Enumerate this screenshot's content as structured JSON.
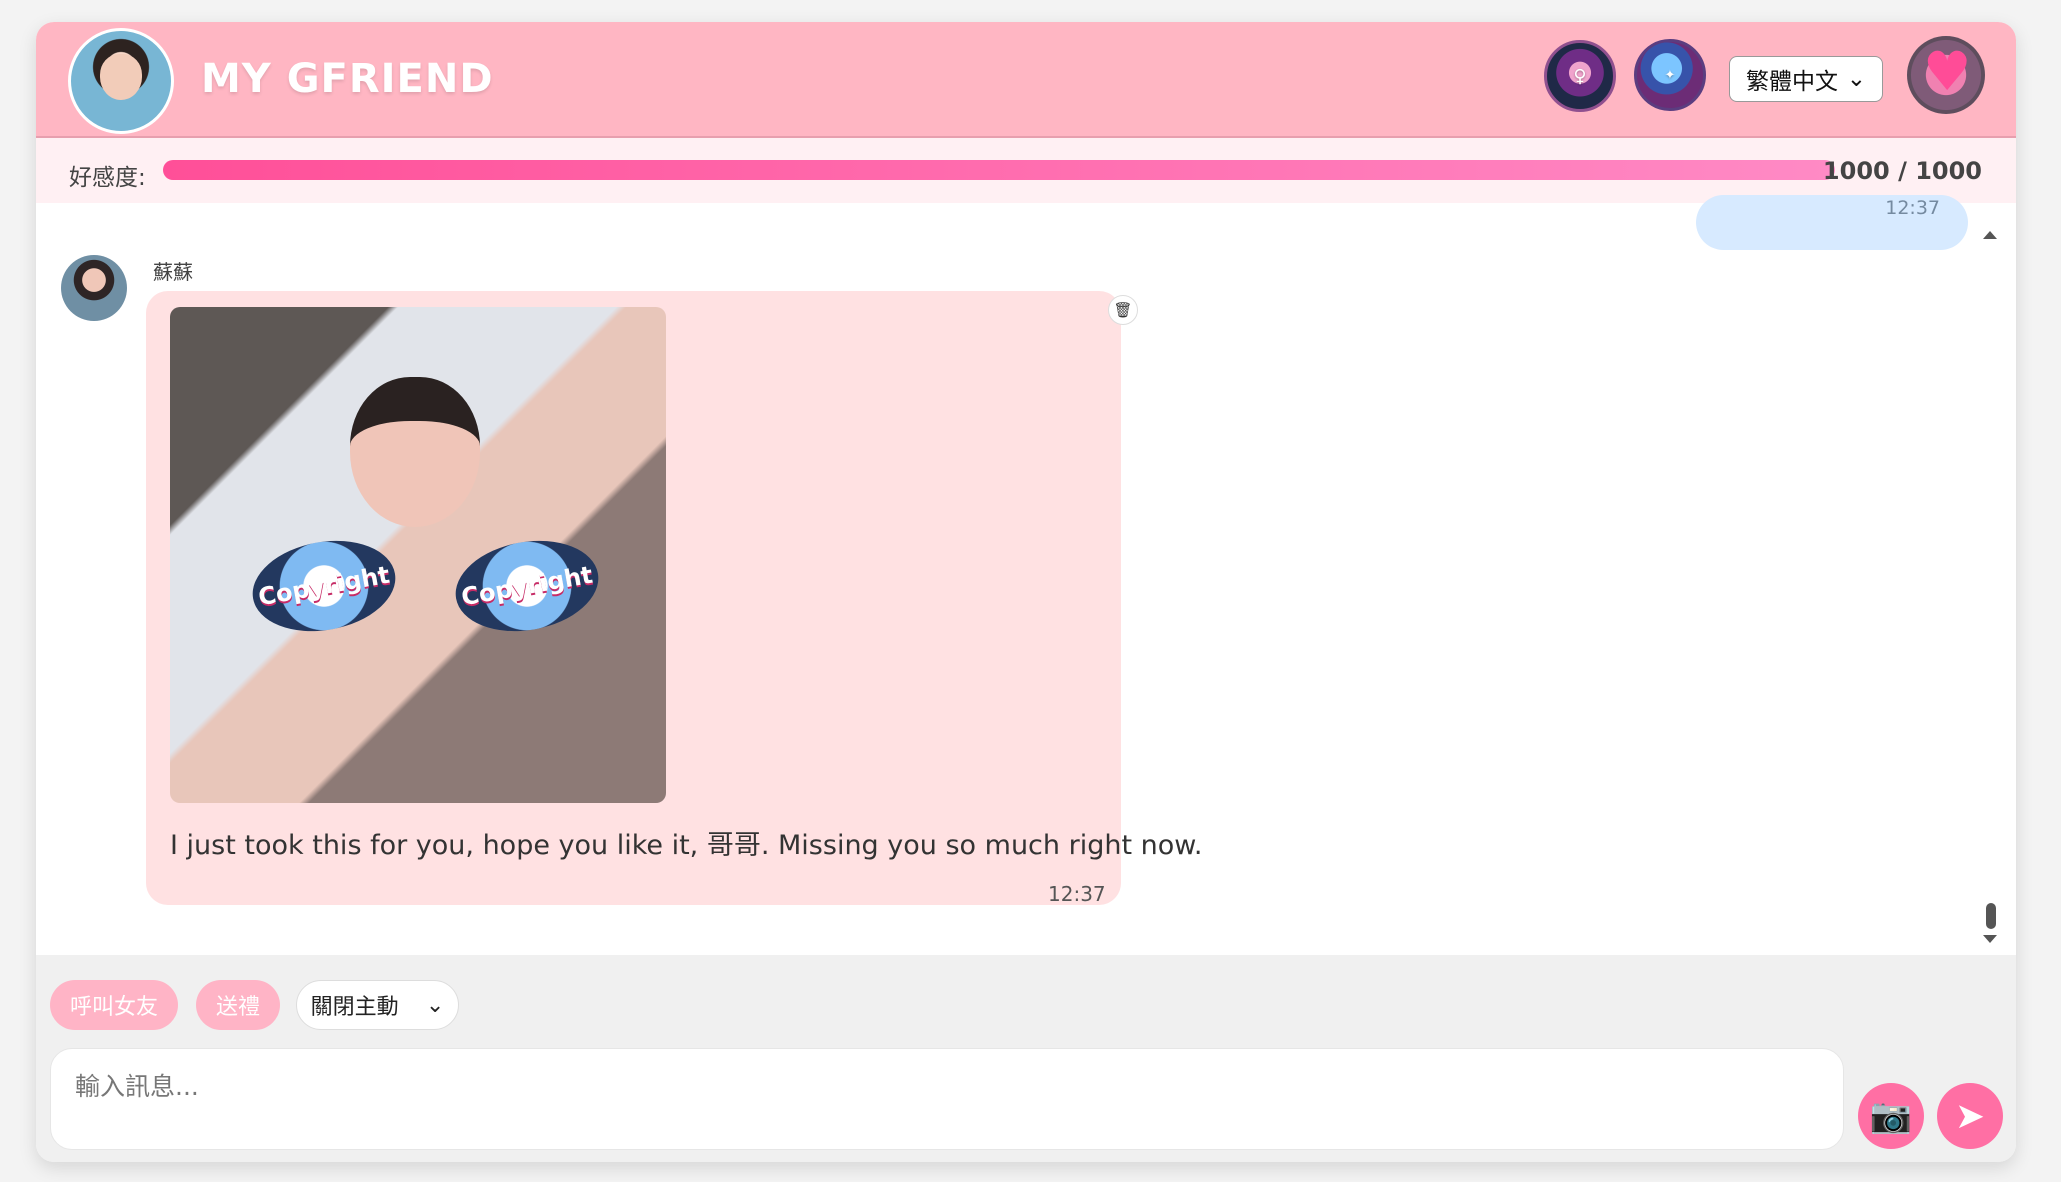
{
  "header": {
    "title": "MY GFRIEND",
    "language": "繁體中文"
  },
  "favorability": {
    "label": "好感度:",
    "current": 1000,
    "max": 1000,
    "display": "1000 / 1000",
    "fill_ratio": 1
  },
  "chat": {
    "previous_time_partial": "12:37",
    "sender": "蘇蘇",
    "message": "I just took this for you, hope you like it, 哥哥. Missing you so much right now.",
    "time": "12:37",
    "image_badges": [
      "Copyright",
      "Copyright"
    ]
  },
  "footer": {
    "call_button": "呼叫女友",
    "gift_button": "送禮",
    "mode": "關閉主動",
    "input_placeholder": "輸入訊息..."
  },
  "colors": {
    "header": "#ffb6c3",
    "message_bubble": "#ffe1e2",
    "accent": "#ff6fa4"
  }
}
